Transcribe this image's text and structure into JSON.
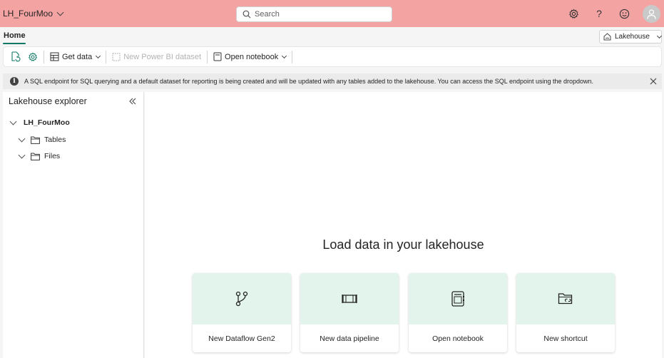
{
  "header": {
    "workspace_name": "LH_FourMoo",
    "search_placeholder": "Search"
  },
  "tabs": {
    "home": "Home"
  },
  "switcher": {
    "label": "Lakehouse"
  },
  "toolbar": {
    "get_data": "Get data",
    "new_dataset": "New Power BI dataset",
    "open_notebook": "Open notebook"
  },
  "info": {
    "message": "A SQL endpoint for SQL querying and a default dataset for reporting is being created and will be updated with any tables added to the lakehouse. You can access the SQL endpoint using the dropdown."
  },
  "explorer": {
    "title": "Lakehouse explorer",
    "root": "LH_FourMoo",
    "folders": [
      "Tables",
      "Files"
    ]
  },
  "main": {
    "title": "Load data in your lakehouse",
    "cards": [
      {
        "label": "New Dataflow Gen2",
        "icon": "dataflow-icon"
      },
      {
        "label": "New data pipeline",
        "icon": "pipeline-icon"
      },
      {
        "label": "Open notebook",
        "icon": "notebook-icon"
      },
      {
        "label": "New shortcut",
        "icon": "shortcut-folder-icon"
      }
    ]
  },
  "colors": {
    "header_bg": "#f4a3a3",
    "accent": "#117865",
    "card_top": "#e3f4ec"
  }
}
